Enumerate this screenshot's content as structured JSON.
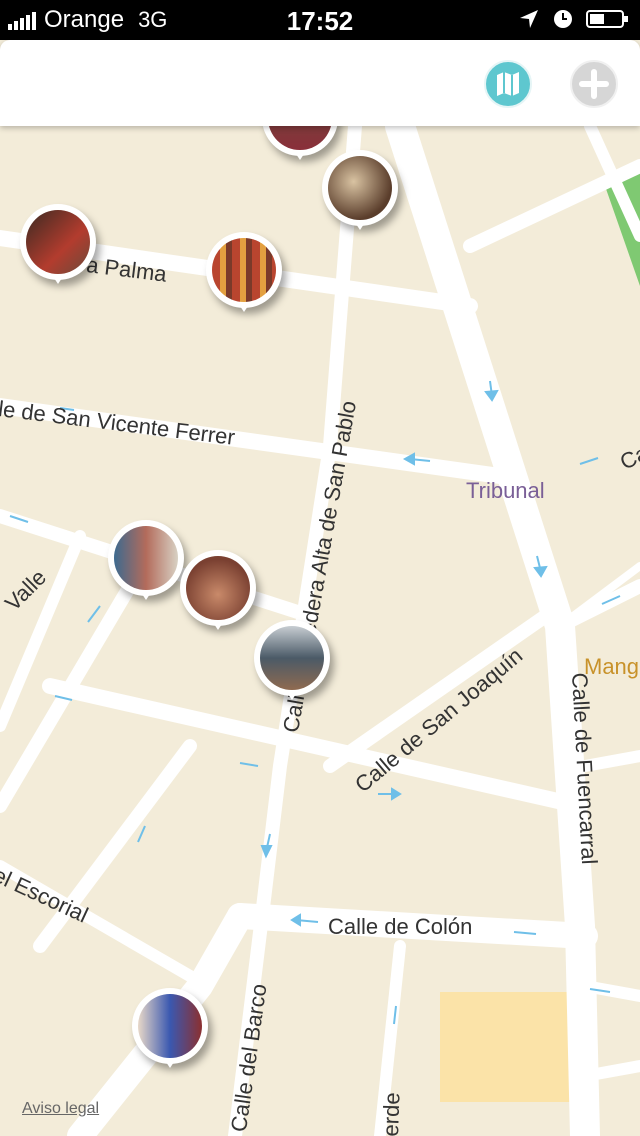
{
  "status_bar": {
    "carrier": "Orange",
    "network": "3G",
    "time": "17:52"
  },
  "nav": {
    "map_icon": "map-icon",
    "add_icon": "plus-icon",
    "accent": "#5ec7cf"
  },
  "map": {
    "streets": [
      {
        "id": "palma",
        "label": "a Palma"
      },
      {
        "id": "san-vicente",
        "label": "le de San Vicente Ferrer"
      },
      {
        "id": "alta-san-pablo",
        "label": "Calle Corredera Alta de San Pablo"
      },
      {
        "id": "san-joaquin",
        "label": "Calle de San Joaquín"
      },
      {
        "id": "fuencarral",
        "label": "Calle de Fuencarral"
      },
      {
        "id": "colon",
        "label": "Calle de Colón"
      },
      {
        "id": "barco",
        "label": "Calle del Barco"
      },
      {
        "id": "escorial",
        "label": "el Escorial"
      },
      {
        "id": "valle",
        "label": "Valle"
      },
      {
        "id": "verde",
        "label": "erde"
      },
      {
        "id": "ca",
        "label": "Ca"
      }
    ],
    "places": [
      {
        "label": "Tribunal",
        "color": "#7a5f97"
      },
      {
        "label": "Mang",
        "color": "#c8922a"
      }
    ],
    "legal_link": "Aviso legal",
    "colors": {
      "land": "#f3ecd9",
      "road": "#ffffff",
      "park": "#7fc972",
      "block": "#fbe3a8",
      "arrow": "#6fbfe8"
    }
  },
  "pins": [
    {
      "name": "shop-pin-1",
      "palette": [
        "#3a2a22",
        "#b33c2e"
      ]
    },
    {
      "name": "shop-pin-2",
      "palette": [
        "#5a3d2b",
        "#d9c3a2"
      ]
    },
    {
      "name": "shop-pin-3",
      "palette": [
        "#8a2f3a",
        "#c95a3f"
      ]
    },
    {
      "name": "shop-pin-4",
      "palette": [
        "#b9452f",
        "#e3a040"
      ]
    },
    {
      "name": "shop-pin-5",
      "palette": [
        "#3d6a8f",
        "#b36b5b"
      ]
    },
    {
      "name": "shop-pin-6",
      "palette": [
        "#7a4031",
        "#c98a6a"
      ]
    },
    {
      "name": "shop-pin-7",
      "palette": [
        "#4b5a67",
        "#8f6a50"
      ]
    },
    {
      "name": "shop-pin-8",
      "palette": [
        "#8c2f2f",
        "#3a58b0"
      ]
    }
  ]
}
